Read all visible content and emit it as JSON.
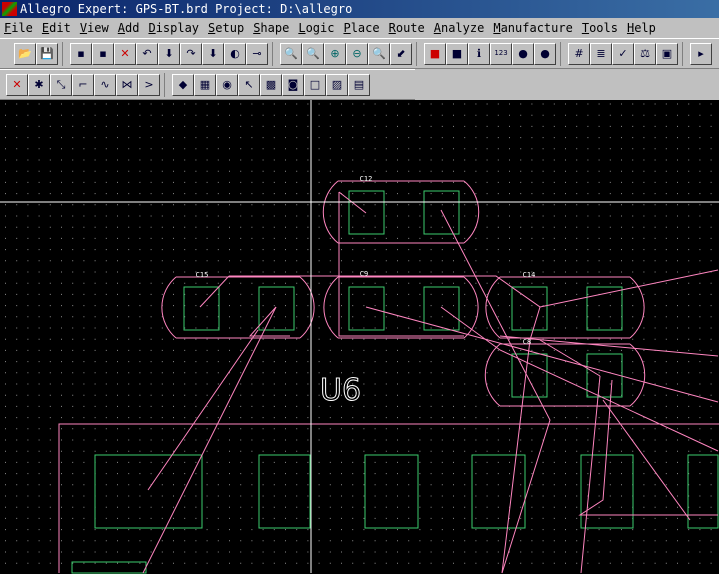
{
  "window": {
    "title": "Allegro Expert: GPS-BT.brd  Project: D:\\allegro"
  },
  "menu": [
    "File",
    "Edit",
    "View",
    "Add",
    "Display",
    "Setup",
    "Shape",
    "Logic",
    "Place",
    "Route",
    "Analyze",
    "Manufacture",
    "Tools",
    "Help"
  ],
  "toolbar1": [
    [
      "open-icon",
      "📂"
    ],
    [
      "save-icon",
      "💾"
    ],
    null,
    [
      "move-icon",
      "▪"
    ],
    [
      "copy-icon",
      "▪"
    ],
    [
      "delete-icon",
      "✕"
    ],
    [
      "undo-icon",
      "↶"
    ],
    [
      "undo-down-icon",
      "⬇"
    ],
    [
      "redo-icon",
      "↷"
    ],
    [
      "redo-down-icon",
      "⬇"
    ],
    [
      "shape-icon",
      "◐"
    ],
    [
      "pin-icon",
      "⊸"
    ],
    null,
    [
      "zoom-fit-icon",
      "🔍"
    ],
    [
      "zoom-icon",
      "🔍"
    ],
    [
      "zoom-in-icon",
      "⊕"
    ],
    [
      "zoom-out-icon",
      "⊖"
    ],
    [
      "zoom-prev-icon",
      "🔍"
    ],
    [
      "refresh-icon",
      "⬋"
    ],
    null,
    [
      "color-icon",
      "■"
    ],
    [
      "layer-visibility-icon",
      "■"
    ],
    [
      "info-icon",
      "ℹ"
    ],
    [
      "measure-icon",
      "123"
    ],
    [
      "highlight-icon",
      "●"
    ],
    [
      "dehighlight-icon",
      "●"
    ],
    null,
    [
      "grid-icon",
      "#"
    ],
    [
      "layers-icon",
      "≣"
    ],
    [
      "drc-icon",
      "✓"
    ],
    [
      "balance-icon",
      "⚖"
    ],
    [
      "chip-icon",
      "▣"
    ],
    null,
    [
      "more-icon",
      "▸"
    ]
  ],
  "toolbar2": [
    [
      "unroute-icon",
      "✕"
    ],
    [
      "ratsnest-icon",
      "✱"
    ],
    [
      "add-connect-icon",
      "⤡"
    ],
    [
      "slide-icon",
      "⌐"
    ],
    [
      "delay-tune-icon",
      "∿"
    ],
    [
      "custom-smooth-icon",
      "⋈"
    ],
    [
      "fanout-icon",
      ">"
    ],
    null,
    [
      "select-shape-icon",
      "◆"
    ],
    [
      "shape-fill-icon",
      "▦"
    ],
    [
      "circle-shape-icon",
      "◉"
    ],
    [
      "pointer-icon",
      "↖"
    ],
    [
      "shape-edit-icon",
      "▩"
    ],
    [
      "shape-void-icon",
      "◙"
    ],
    [
      "rect-shape-icon",
      "□"
    ],
    [
      "merge-shape-icon",
      "▨"
    ],
    [
      "shape-check-icon",
      "▤"
    ]
  ],
  "board": {
    "refdes": [
      "C12",
      "C15",
      "C9",
      "C14",
      "C8"
    ],
    "component_label": "U6",
    "colors": {
      "pad": "#3ccc6e",
      "outline": "#ff86c0",
      "ratsnest": "#ff86c0",
      "grid": "#c8c8c8",
      "crosshair": "#ffffff"
    }
  }
}
